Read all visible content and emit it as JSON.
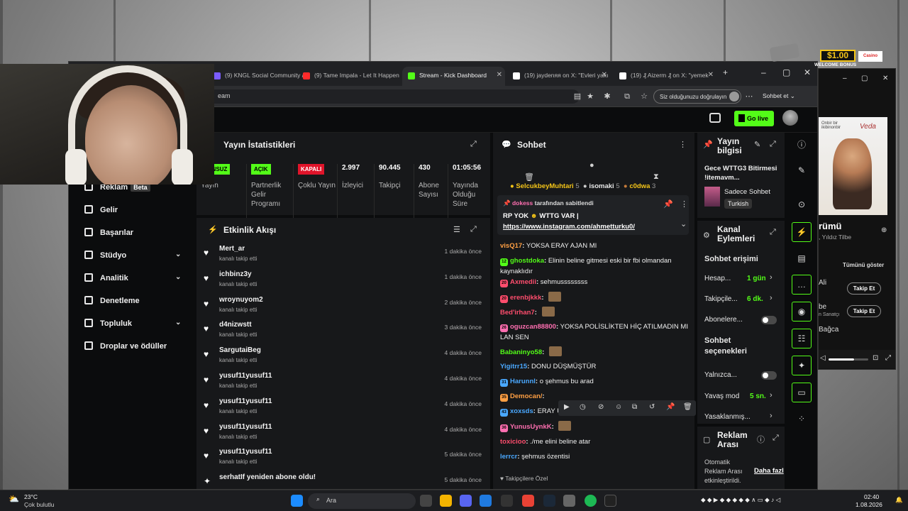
{
  "browser": {
    "tabs": [
      {
        "label": "(9) KNGL Social Community /",
        "color": "#7b5cff"
      },
      {
        "label": "(9) Tame Impala - Let It Happen",
        "color": "#ff2a2a"
      },
      {
        "label": "Stream - Kick Dashboard",
        "color": "#53fc18"
      },
      {
        "label": "(19) jaydenяя on X: \"Evleri yakı",
        "color": "#ffffff"
      },
      {
        "label": "(19) ₰ Aizerm ₰ on X: \"yemek",
        "color": "#ffffff"
      }
    ],
    "url_fragment": "eam",
    "verify_label": "Siz olduğunuzu doğrulayın",
    "sohbet_et": "Sohbet et"
  },
  "header": {
    "go_live": "Go live"
  },
  "sidebar": {
    "items": [
      {
        "label": "Reklam",
        "badge": "Beta"
      },
      {
        "label": "Gelir"
      },
      {
        "label": "Başarılar"
      },
      {
        "label": "Stüdyo"
      },
      {
        "label": "Analitik"
      },
      {
        "label": "Denetleme"
      },
      {
        "label": "Topluluk"
      },
      {
        "label": "Droplar ve ödüller"
      }
    ]
  },
  "stats": {
    "title": "Yayın İstatistikleri",
    "cells": [
      {
        "value": "RUNSUZ",
        "label": "Yayın"
      },
      {
        "value": "AÇIK",
        "label": "Partnerlik Gelir Programı"
      },
      {
        "value": "KAPALI",
        "label": "Çoklu Yayın"
      },
      {
        "value": "2.997",
        "label": "İzleyici"
      },
      {
        "value": "90.445",
        "label": "Takipçi"
      },
      {
        "value": "430",
        "label": "Abone Sayısı"
      },
      {
        "value": "01:05:56",
        "label": "Yayında Olduğu Süre"
      }
    ]
  },
  "activity": {
    "title": "Etkinlik Akışı",
    "rows": [
      {
        "name": "Mert_ar",
        "sub": "kanalı takip etti",
        "time": "1 dakika önce"
      },
      {
        "name": "ichbinz3y",
        "sub": "kanalı takip etti",
        "time": "1 dakika önce"
      },
      {
        "name": "wroynuyom2",
        "sub": "kanalı takip etti",
        "time": "2 dakika önce"
      },
      {
        "name": "d4nizwstt",
        "sub": "kanalı takip etti",
        "time": "3 dakika önce"
      },
      {
        "name": "SargutaiBeg",
        "sub": "kanalı takip etti",
        "time": "4 dakika önce"
      },
      {
        "name": "yusuf11yusuf11",
        "sub": "kanalı takip etti",
        "time": "4 dakika önce"
      },
      {
        "name": "yusuf11yusuf11",
        "sub": "kanalı takip etti",
        "time": "4 dakika önce"
      },
      {
        "name": "yusuf11yusuf11",
        "sub": "kanalı takip etti",
        "time": "4 dakika önce"
      },
      {
        "name": "yusuf11yusuf11",
        "sub": "kanalı takip etti",
        "time": "5 dakika önce"
      },
      {
        "name": "serhatIf yeniden abone oldu!",
        "sub": "",
        "time": "5 dakika önce"
      }
    ]
  },
  "chat": {
    "title": "Sohbet",
    "top_gifters": [
      {
        "name": "SelcukbeyMuhtari",
        "count": "5"
      },
      {
        "name": "isomaki",
        "count": "5"
      },
      {
        "name": "c0dwa",
        "count": "3"
      }
    ],
    "pinned": {
      "by": "dokess",
      "by_suffix": "tarafından sabitlendi",
      "text": "RP YOK",
      "text2": "WTTG VAR |",
      "link": "https://www.instagram.com/ahmetturku0/"
    },
    "messages": [
      {
        "user": "visQ17",
        "color": "#ff9f43",
        "text": "YOKSA ERAY AJAN MI",
        "badge": ""
      },
      {
        "user": "ghostdoka",
        "color": "#53fc18",
        "text": "Elinin beline gitmesi eski bir fbi olmandan kaynaklıdır",
        "badge": "12"
      },
      {
        "user": "Axmedii",
        "color": "#ff4d6d",
        "text": "sehmussssssss",
        "badge": "20"
      },
      {
        "user": "erenbjkkk",
        "color": "#ff4d6d",
        "text": "",
        "badge": "20"
      },
      {
        "user": "Bed'irhan7",
        "color": "#ff4d6d",
        "text": "",
        "badge": ""
      },
      {
        "user": "oguzcan88800",
        "color": "#ff6fb1",
        "text": "YOKSA POLİSLİKTEN HİÇ ATILMADIN MI LAN SEN",
        "badge": "26"
      },
      {
        "user": "Babaninyo58",
        "color": "#53fc18",
        "text": "",
        "badge": ""
      },
      {
        "user": "Yigitrr15",
        "color": "#4aa8ff",
        "text": "DONU DÜŞMÜŞTÜR",
        "badge": ""
      },
      {
        "user": "Harunnl",
        "color": "#4aa8ff",
        "text": "o şehmus bu arad",
        "badge": "31"
      },
      {
        "user": "Democan/",
        "color": "#ff9f43",
        "text": "",
        "badge": "35"
      },
      {
        "user": "xoxsds",
        "color": "#4aa8ff",
        "text": "ERAY ULAŞ",
        "badge": "43"
      },
      {
        "user": "YunusUynkK",
        "color": "#ff6fb1",
        "text": "",
        "badge": "36"
      },
      {
        "user": "toxicioo",
        "color": "#ff4d6d",
        "text": "./me elini beline atar",
        "badge": ""
      },
      {
        "user": "lerrcr",
        "color": "#4aa8ff",
        "text": "şehmus özentisi",
        "badge": ""
      }
    ],
    "footer": "Takipçilere Özel"
  },
  "stream_info": {
    "title": "Yayın bilgisi",
    "stream_title": "Gece WTTG3 Bitirmesi !itemavm...",
    "category": "Sadece Sohbet",
    "language": "Turkish"
  },
  "channel_actions": {
    "title": "Kanal Eylemleri",
    "chat_access": "Sohbet erişimi",
    "rows": [
      {
        "label": "Hesap...",
        "value": "1 gün"
      },
      {
        "label": "Takipçile...",
        "value": "6 dk."
      },
      {
        "label": "Abonelere...",
        "value": ""
      }
    ],
    "chat_options": "Sohbet seçenekleri",
    "rows2": [
      {
        "label": "Yalnızca...",
        "value": ""
      },
      {
        "label": "Yavaş mod",
        "value": "5 sn."
      },
      {
        "label": "Yasaklanmış...",
        "value": ""
      }
    ]
  },
  "ad_break": {
    "title": "Reklam Arası",
    "desc": "Otomatik Reklam Arası etkinleştirildi.",
    "link": "Daha fazl"
  },
  "spotify": {
    "art_text": "Onbir bir ikibinonbir",
    "art_brand": "Veda",
    "track": "rümü",
    "artist": ", Yıldız Tilbe",
    "show_all": "Tümünü göster",
    "artist1": "Ali",
    "artist2": "be",
    "artist2_sub": "n Sanatçı",
    "artist3": "Bağca",
    "follow": "Takip Et"
  },
  "ad": {
    "amount": "$1.00",
    "bonus": "WELCOME BONUS",
    "brand": "Casino"
  },
  "taskbar": {
    "temp": "23°C",
    "weather": "Çok bulutlu",
    "search": "Ara",
    "time": "02:40",
    "date": "1.08.2026"
  }
}
